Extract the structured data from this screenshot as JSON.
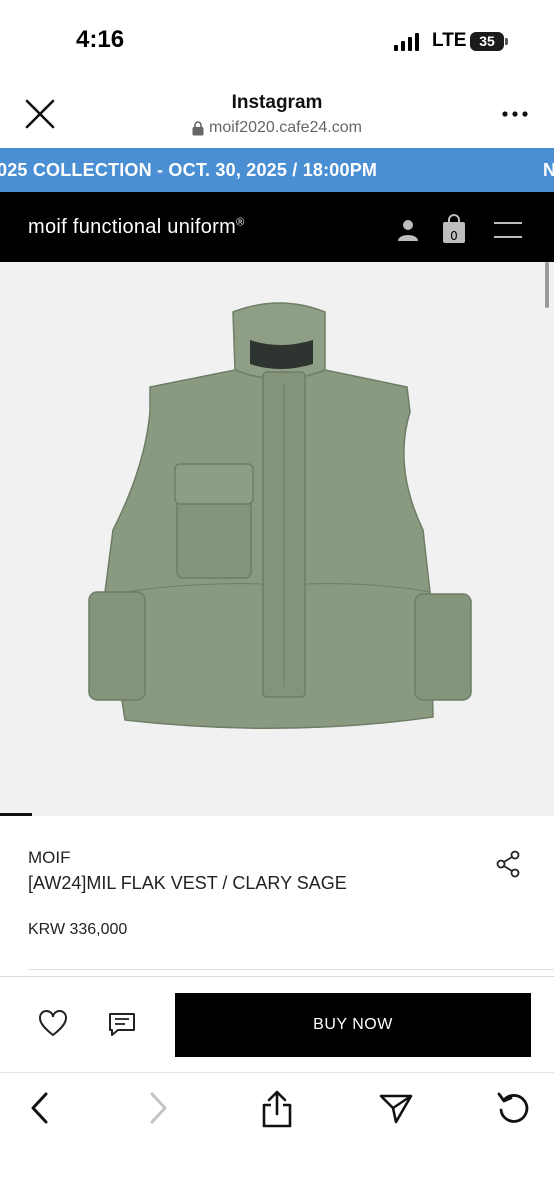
{
  "status_bar": {
    "time": "4:16",
    "network": "LTE",
    "battery": "35"
  },
  "browser": {
    "title": "Instagram",
    "url": "moif2020.cafe24.com",
    "close_icon": "close-icon",
    "more_icon": "more-icon"
  },
  "banner": {
    "text": "025 COLLECTION - OCT. 30, 2025 / 18:00PM",
    "right_fragment": "N"
  },
  "site": {
    "logo": "moif functional uniform",
    "logo_mark": "®",
    "cart_count": "0",
    "icons": [
      "user-icon",
      "shopping-bag-icon",
      "hamburger-menu-icon"
    ]
  },
  "product": {
    "brand": "MOIF",
    "name": "[AW24]MIL FLAK VEST / CLARY SAGE",
    "price": "KRW 336,000",
    "image_colour": "#8a9a80"
  },
  "actions": {
    "buy_label": "BUY NOW",
    "icons": [
      "heart-icon",
      "chat-icon"
    ]
  },
  "toolbar": {
    "icons": [
      "back-icon",
      "forward-icon",
      "share-icon",
      "send-icon",
      "reload-icon"
    ]
  },
  "colors": {
    "banner": "#4a8fd4",
    "nav_bg": "#000000",
    "buy_bg": "#000000",
    "image_bg": "#f1f1f1"
  }
}
